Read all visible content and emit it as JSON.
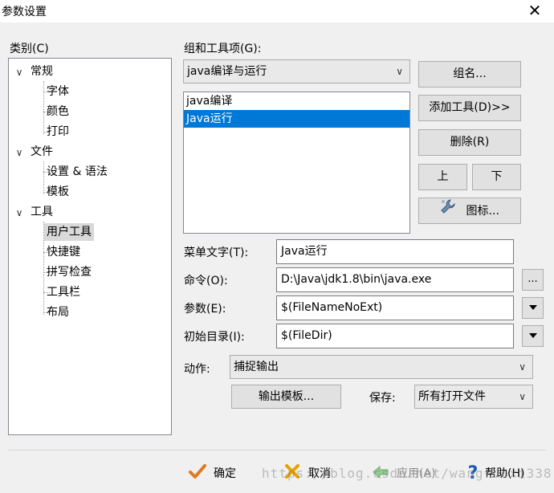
{
  "window": {
    "title": "参数设置",
    "close_glyph": "✕"
  },
  "category": {
    "label": "类别(C)",
    "tree": {
      "groups": [
        {
          "label": "常规",
          "children": [
            "字体",
            "颜色",
            "打印"
          ]
        },
        {
          "label": "文件",
          "children": [
            "设置 & 语法",
            "模板"
          ]
        },
        {
          "label": "工具",
          "children": [
            "用户工具",
            "快捷键",
            "拼写检查",
            "工具栏",
            "布局"
          ]
        }
      ],
      "selected": "用户工具"
    }
  },
  "tools": {
    "group_label": "组和工具项(G):",
    "group_value": "java编译与运行",
    "items": [
      "java编译",
      "Java运行"
    ],
    "selected_item": "Java运行",
    "buttons": {
      "group_name": "组名...",
      "add_tool": "添加工具(D)>>",
      "delete": "删除(R)",
      "up": "上",
      "down": "下",
      "icon": "图标..."
    }
  },
  "fields": {
    "menu_text": {
      "label": "菜单文字(T):",
      "value": "Java运行"
    },
    "command": {
      "label": "命令(O):",
      "value": "D:\\Java\\jdk1.8\\bin\\java.exe",
      "browse": "..."
    },
    "params": {
      "label": "参数(E):",
      "value": "$(FileNameNoExt)"
    },
    "init_dir": {
      "label": "初始目录(I):",
      "value": "$(FileDir)"
    }
  },
  "action": {
    "label": "动作:",
    "value": "捕捉输出"
  },
  "output_template_button": "输出模板...",
  "save": {
    "label": "保存:",
    "value": "所有打开文件"
  },
  "footer": {
    "ok": "确定",
    "cancel": "取消",
    "apply": "应用(A)",
    "help": "帮助(H)"
  },
  "watermark": "https://blog.csdn.net/wangruoxi338",
  "colors": {
    "selection": "#0078d7",
    "ok_check": "#e07a1f",
    "cancel_x": "#e8a200",
    "help_q": "#1e5bb8"
  }
}
